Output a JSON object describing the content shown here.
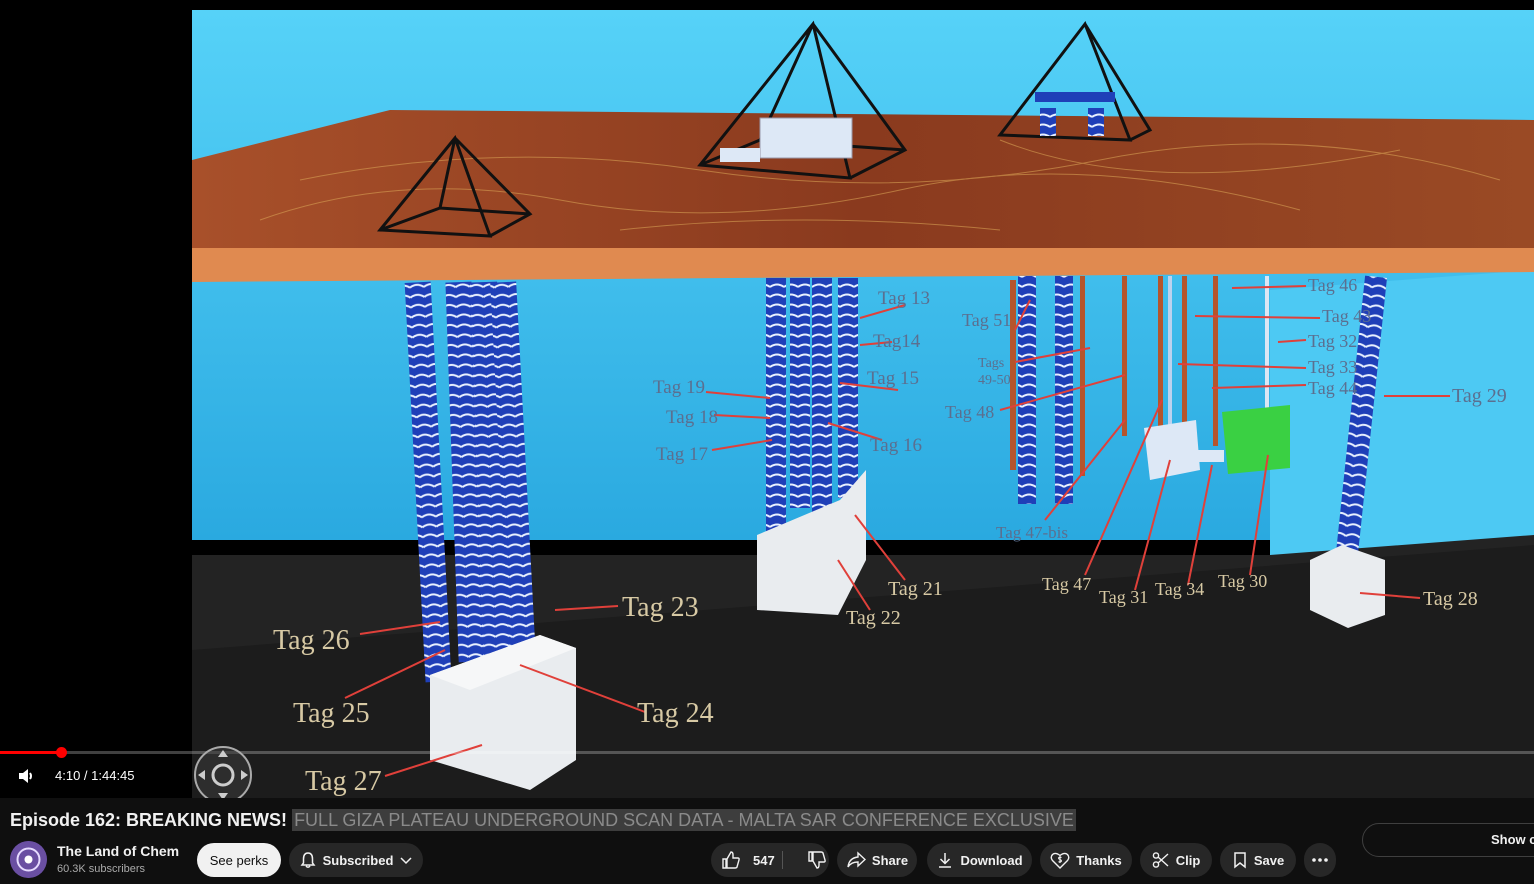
{
  "video": {
    "current_time": "4:10",
    "duration": "1:44:45",
    "time_display": "4:10 / 1:44:45",
    "progress_fraction": 0.0398,
    "scene_labels": [
      "Tag 13",
      "Tag14",
      "Tag 15",
      "Tag 16",
      "Tag 17",
      "Tag 18",
      "Tag 19",
      "Tag 21",
      "Tag 22",
      "Tag 23",
      "Tag 24",
      "Tag 25",
      "Tag 26",
      "Tag 27",
      "Tag 28",
      "Tag 29",
      "Tag 30",
      "Tag 31",
      "Tag 32",
      "Tag 33",
      "Tag 34",
      "Tag 43",
      "Tag 44",
      "Tag 46",
      "Tag 47",
      "Tag 47-bis",
      "Tag 48",
      "Tag 51",
      "Tags",
      "49-50"
    ]
  },
  "title": {
    "prefix": "Episode 162: BREAKING NEWS!",
    "highlight": "FULL GIZA PLATEAU UNDERGROUND SCAN DATA - MALTA SAR CONFERENCE EXCLUSIVE"
  },
  "channel": {
    "name": "The Land of Chem",
    "subscribers": "60.3K subscribers"
  },
  "actions": {
    "see_perks": "See perks",
    "subscribed": "Subscribed",
    "like_count": "547",
    "share": "Share",
    "download": "Download",
    "thanks": "Thanks",
    "clip": "Clip",
    "save": "Save",
    "show_chat": "Show chat"
  },
  "icons": {
    "volume": "volume-icon",
    "bell": "bell-icon",
    "chevron": "chevron-down-icon",
    "like": "thumbs-up-icon",
    "dislike": "thumbs-down-icon",
    "share": "share-arrow-icon",
    "download": "download-icon",
    "thanks": "dollar-heart-icon",
    "clip": "scissors-icon",
    "save": "bookmark-icon",
    "more": "more-dots-icon",
    "nav": "move-pad-icon"
  },
  "colors": {
    "progress": "#ff0000",
    "page_bg": "#0f0f0f",
    "pill_bg": "#272727",
    "scene_wall": "#3ec0ee",
    "scene_floor": "#1a1a1a",
    "plate": "#d9773f",
    "label_text": "#5b6f90",
    "label_line": "#e0403a"
  }
}
